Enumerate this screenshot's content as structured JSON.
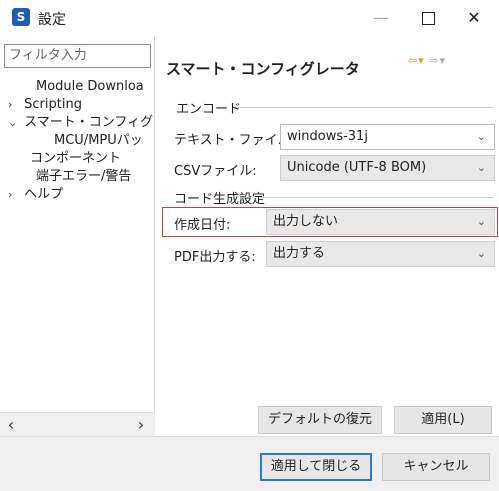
{
  "window": {
    "title": "設定",
    "app_icon_letter": "S"
  },
  "controls": {
    "minimize": "—",
    "close": "✕"
  },
  "left": {
    "filter_placeholder": "フィルタ入力",
    "tree": [
      {
        "label": "Module Downloa",
        "chevron": "",
        "indent": 1
      },
      {
        "label": "Scripting",
        "chevron": "›",
        "indent": 0
      },
      {
        "label": "スマート・コンフィグレ",
        "chevron": "⌄",
        "indent": 0
      },
      {
        "label": "MCU/MPUパッ",
        "chevron": "",
        "indent": 2
      },
      {
        "label": "コンポーネント",
        "chevron": "",
        "indent": 2
      },
      {
        "label": "端子エラー/警告",
        "chevron": "",
        "indent": 2
      },
      {
        "label": "ヘルプ",
        "chevron": "›",
        "indent": 0
      }
    ]
  },
  "right": {
    "title": "スマート・コンフィグレータ",
    "encode_group": "エンコード",
    "text_file_label": "テキスト・ファイル:",
    "text_file_value": "windows-31j",
    "csv_file_label": "CSVファイル:",
    "csv_file_value": "Unicode (UTF-8 BOM)",
    "codegen_group": "コード生成設定",
    "created_date_label": "作成日付:",
    "created_date_value": "出力しない",
    "pdf_label": "PDF出力する:",
    "pdf_value": "出力する",
    "restore_defaults": "デフォルトの復元(T)",
    "apply": "適用(L)"
  },
  "footer": {
    "apply_close": "適用して閉じる",
    "cancel": "キャンセル"
  },
  "colors": {
    "highlight": "#d23b3b",
    "primary_border": "#2b7bd0",
    "app_icon": "#1d5fae"
  }
}
